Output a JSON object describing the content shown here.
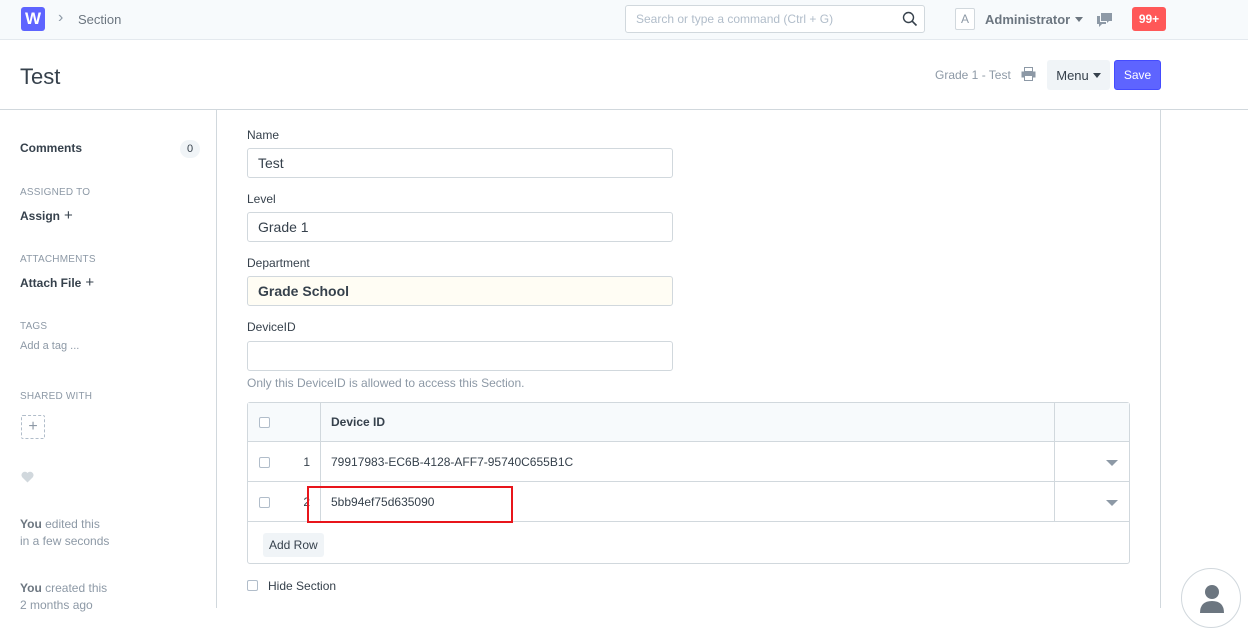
{
  "navbar": {
    "logo_letter": "W",
    "breadcrumb": "Section",
    "search_placeholder": "Search or type a command (Ctrl + G)",
    "avatar_letter": "A",
    "user_name": "Administrator",
    "notification_count": "99+"
  },
  "header": {
    "title": "Test",
    "indicator": "Grade 1 - Test",
    "menu_label": "Menu",
    "save_label": "Save"
  },
  "sidebar": {
    "comments_label": "Comments",
    "comments_count": "0",
    "assigned_to_label": "ASSIGNED TO",
    "assign_link": "Assign",
    "attachments_label": "ATTACHMENTS",
    "attach_link": "Attach File",
    "tags_label": "TAGS",
    "add_tag": "Add a tag ...",
    "shared_with_label": "SHARED WITH",
    "activity": [
      {
        "who": "You",
        "what": "edited this",
        "when": "in a few seconds"
      },
      {
        "who": "You",
        "what": "created this",
        "when": "2 months ago"
      }
    ]
  },
  "form": {
    "name_label": "Name",
    "name_value": "Test",
    "level_label": "Level",
    "level_value": "Grade 1",
    "department_label": "Department",
    "department_value": "Grade School",
    "deviceid_label": "DeviceID",
    "deviceid_value": "",
    "deviceid_description": "Only this DeviceID is allowed to access this Section.",
    "grid": {
      "column_header": "Device ID",
      "rows": [
        {
          "idx": "1",
          "device_id": "79917983-EC6B-4128-AFF7-95740C655B1C"
        },
        {
          "idx": "2",
          "device_id": "5bb94ef75d635090"
        }
      ],
      "add_row_label": "Add Row"
    },
    "hide_section_label": "Hide Section"
  },
  "colors": {
    "primary": "#5e64ff",
    "notification": "#ff5858",
    "highlight_box": "#e8151b"
  }
}
